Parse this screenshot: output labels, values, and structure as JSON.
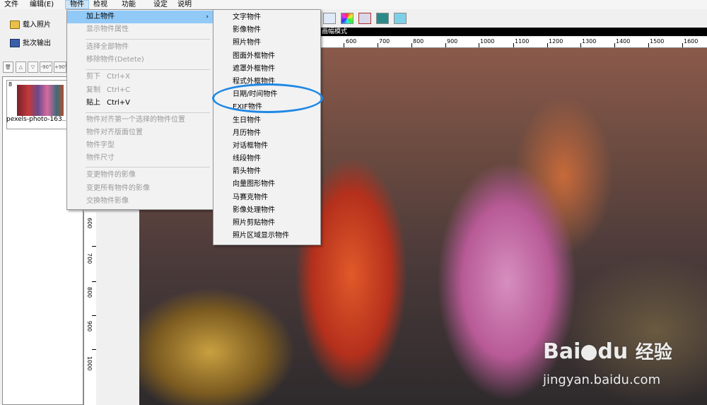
{
  "menubar": {
    "items": [
      "文件",
      "编辑(E)",
      "物件",
      "检视",
      "功能",
      "设定",
      "说明"
    ]
  },
  "left_buttons": {
    "load": "载入照片",
    "batch": "批次输出"
  },
  "small_toolbar": [
    "△",
    "▽",
    "-90°",
    "+90°"
  ],
  "thumbnail": {
    "index": "8",
    "filename": "pexels-photo-163..."
  },
  "canvas_bar_label": "画幅模式",
  "hruler": [
    "600",
    "700",
    "800",
    "900",
    "1000",
    "1100",
    "1200",
    "1300",
    "1400",
    "1500",
    "1600"
  ],
  "vruler": [
    "600",
    "700",
    "800",
    "900",
    "1000"
  ],
  "object_menu": {
    "add": "加上物件",
    "show_props": "显示物件属性",
    "select_all": "选择全部物件",
    "delete": "移除物件(Detete)",
    "cut": "剪下",
    "cut_key": "Ctrl+X",
    "copy": "复制",
    "copy_key": "Ctrl+C",
    "paste": "贴上",
    "paste_key": "Ctrl+V",
    "align_first": "物件对齐第一个选择的物件位置",
    "align_page": "物件对齐版面位置",
    "font": "物件字型",
    "size": "物件尺寸",
    "change_image": "变更物件的影像",
    "change_all_images": "变更所有物件的影像",
    "swap_image": "交换物件影像"
  },
  "add_submenu": [
    "文字物件",
    "影像物件",
    "照片物件",
    "图面外框物件",
    "遮罩外框物件",
    "程式外框物件",
    "日期/时间物件",
    "EXIF物件",
    "生日物件",
    "月历物件",
    "对话框物件",
    "线段物件",
    "箭头物件",
    "向量图形物件",
    "马赛克物件",
    "影像处理物件",
    "照片剪贴物件",
    "照片区域显示物件"
  ],
  "watermark": {
    "brand": "Bai",
    "brand2": "du",
    "cn": "经验",
    "url": "jingyan.baidu.com"
  },
  "colors": {
    "highlight": "#91c9f7",
    "circle": "#1e88e5"
  }
}
